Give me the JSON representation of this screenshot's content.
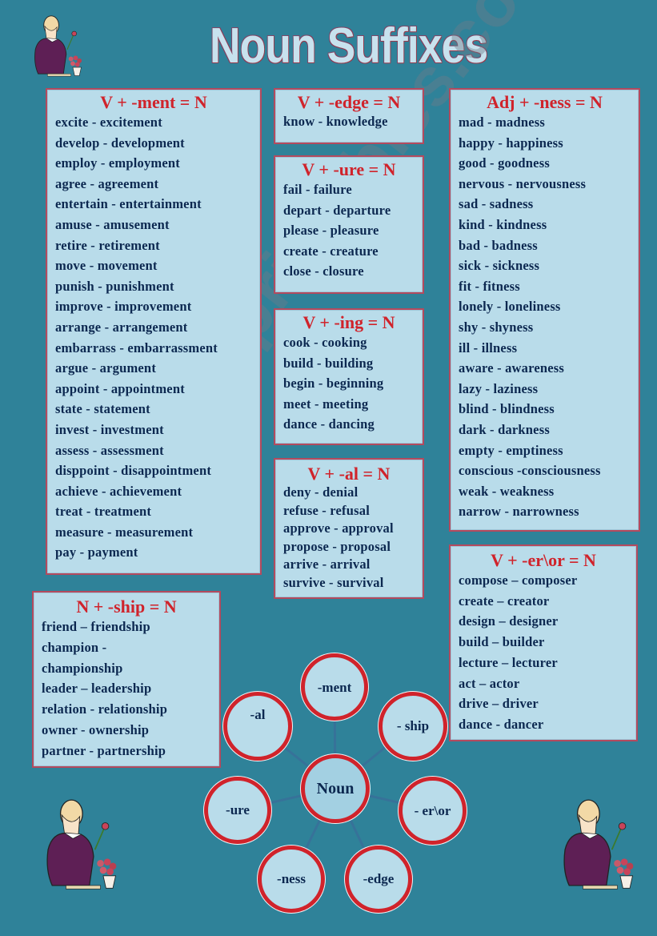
{
  "page": {
    "title": "Noun Suffixes",
    "watermark": "ESLprintables.com",
    "colors": {
      "background": "#2f8299",
      "box_fill": "#b9dcea",
      "heading_red": "#d0232b",
      "text_navy": "#0c2850"
    }
  },
  "sections": {
    "ment": {
      "heading": "V + -ment = N",
      "rows": [
        "excite - excitement",
        "develop - development",
        "employ - employment",
        "agree - agreement",
        "entertain - entertainment",
        "amuse - amusement",
        "retire - retirement",
        "move - movement",
        "punish - punishment",
        "improve - improvement",
        "arrange - arrangement",
        "embarrass - embarrassment",
        "argue - argument",
        "appoint - appointment",
        "state - statement",
        "invest - investment",
        "assess - assessment",
        "disppoint - disappointment",
        "achieve - achievement",
        "treat - treatment",
        "measure - measurement",
        "pay - payment"
      ]
    },
    "edge": {
      "heading": "V + -edge = N",
      "rows": [
        "know - knowledge"
      ]
    },
    "ure": {
      "heading": "V + -ure = N",
      "rows": [
        "fail - failure",
        "depart -  departure",
        "please - pleasure",
        "create - creature",
        "close - closure"
      ]
    },
    "ing": {
      "heading": "V + -ing = N",
      "rows": [
        "cook - cooking",
        "build - building",
        "begin - beginning",
        "meet - meeting",
        "dance - dancing"
      ]
    },
    "al": {
      "heading": "V + -al = N",
      "rows": [
        "deny - denial",
        "refuse - refusal",
        "approve - approval",
        "propose - proposal",
        "arrive - arrival",
        "survive - survival"
      ]
    },
    "ness": {
      "heading": "Adj + -ness = N",
      "rows": [
        "mad - madness",
        "happy - happiness",
        "good - goodness",
        "nervous - nervousness",
        "sad - sadness",
        "kind - kindness",
        "bad - badness",
        "sick - sickness",
        "fit - fitness",
        "lonely - loneliness",
        "shy - shyness",
        "ill - illness",
        "aware - awareness",
        "lazy - laziness",
        "blind - blindness",
        "dark - darkness",
        "empty - emptiness",
        "conscious -consciousness",
        "weak - weakness",
        "narrow - narrowness"
      ]
    },
    "eror": {
      "heading": "V + -er\\or = N",
      "rows": [
        "compose – composer",
        "create – creator",
        "design – designer",
        "build – builder",
        "lecture – lecturer",
        "act – actor",
        "drive – driver",
        "dance - dancer"
      ]
    },
    "ship": {
      "heading": "N + -ship = N",
      "rows": [
        "friend – friendship",
        "champion  -",
        "championship",
        "leader – leadership",
        "relation - relationship",
        "owner - ownership",
        "partner - partnership"
      ]
    }
  },
  "diagram": {
    "center": "Noun",
    "spokes": [
      "-ment",
      "- ship",
      "- er\\or",
      "-edge",
      "-ness",
      "-ure",
      "-al"
    ]
  },
  "illustrations": {
    "icon": "woman-arranging-flowers-icon"
  }
}
